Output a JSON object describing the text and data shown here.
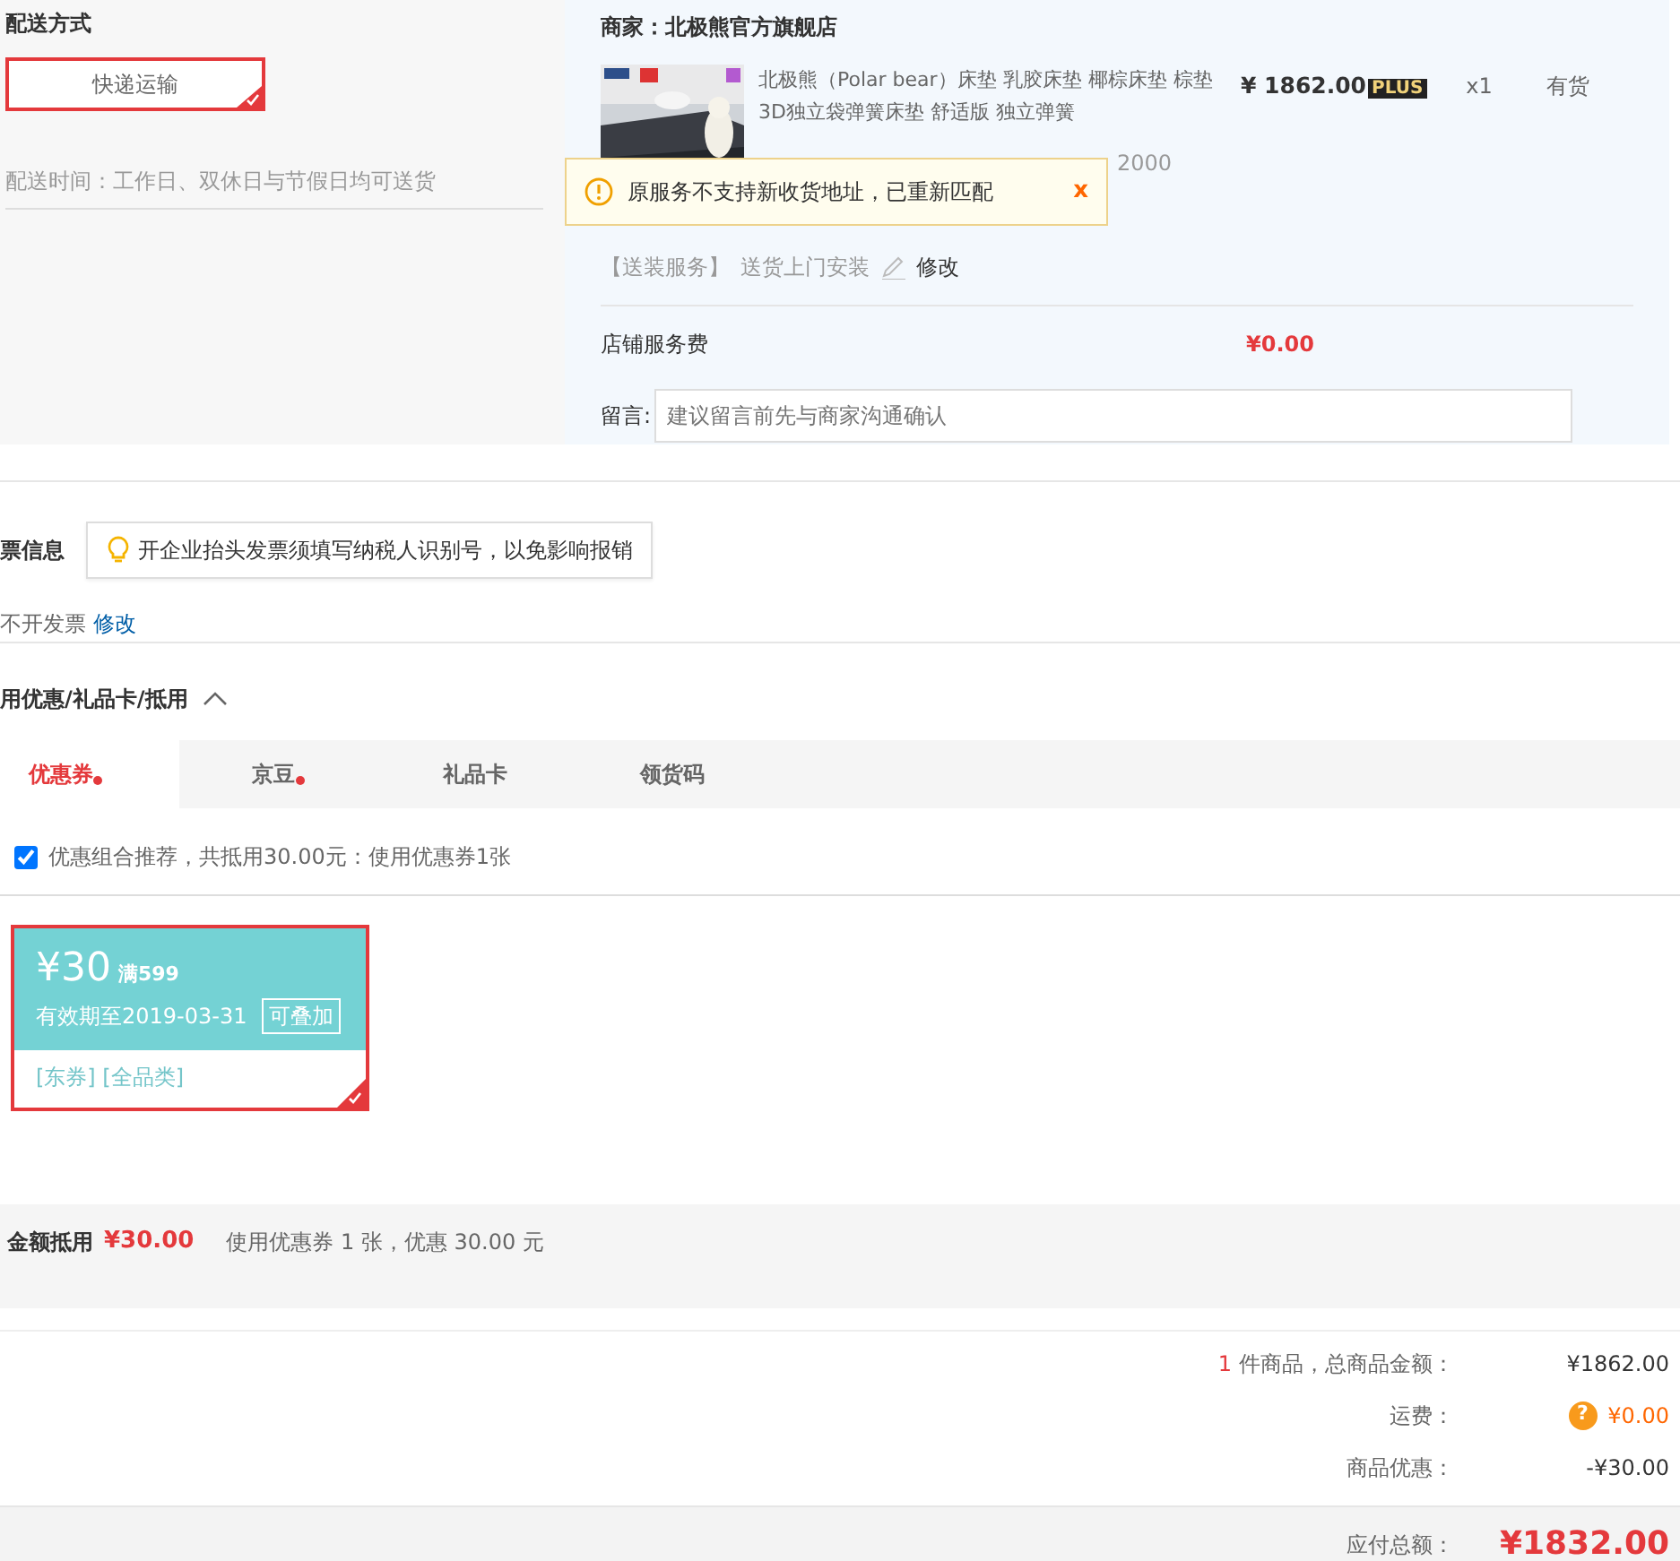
{
  "shipping": {
    "title": "配送方式",
    "method": {
      "label": "快递运输",
      "selected": true
    },
    "time": "配送时间：工作日、双休日与节假日均可送货"
  },
  "shop": {
    "merchant": "商家：北极熊官方旗舰店",
    "product": {
      "name": "北极熊（Polar bear）床垫 乳胶床垫 椰棕床垫 棕垫 3D独立袋弹簧床垫 舒适版 独立弹簧",
      "price": "¥ 1862.00",
      "badge": "PLUS",
      "qty": "x1",
      "stock": "有货",
      "spec": "2000"
    },
    "notice": {
      "text": "原服务不支持新收货地址，已重新匹配",
      "close": "x"
    },
    "service": {
      "label": "【送装服务】",
      "value": "送货上门安装",
      "edit": "修改"
    },
    "fee": {
      "label": "店铺服务费",
      "value": "¥0.00"
    },
    "message": {
      "label": "留言:",
      "placeholder": "建议留言前先与商家沟通确认"
    }
  },
  "invoice": {
    "title": "票信息",
    "tip": "开企业抬头发票须填写纳税人识别号，以免影响报销",
    "value": "不开发票",
    "edit": "修改"
  },
  "discount": {
    "title": "用优惠/礼品卡/抵用",
    "expanded": true,
    "tabs": [
      {
        "label": "优惠券",
        "selected": true,
        "dot": true
      },
      {
        "label": "京豆",
        "selected": false,
        "dot": true
      },
      {
        "label": "礼品卡",
        "selected": false,
        "dot": false
      },
      {
        "label": "领货码",
        "selected": false,
        "dot": false
      }
    ],
    "recommend": {
      "checked": true,
      "text": "优惠组合推荐，共抵用30.00元：使用优惠券1张"
    },
    "coupons": [
      {
        "amount": "¥30",
        "condition": "满599",
        "expiry": "有效期至2019-03-31",
        "tag": "可叠加",
        "scope": "[东券]  [全品类]",
        "selected": true
      }
    ],
    "summary": {
      "label": "金额抵用",
      "amount": "¥30.00",
      "text": "使用优惠券 1 张，优惠 30.00 元"
    }
  },
  "totals": {
    "rows": [
      {
        "count": "1",
        "label": "件商品，总商品金额：",
        "value": "¥1862.00",
        "kind": "plain"
      },
      {
        "label": "运费：",
        "value": "¥0.00",
        "kind": "help",
        "icon": "?"
      },
      {
        "label": "商品优惠：",
        "value": "-¥30.00",
        "kind": "plain"
      }
    ],
    "payable": {
      "label": "应付总额：",
      "value": "¥1832.00"
    }
  }
}
